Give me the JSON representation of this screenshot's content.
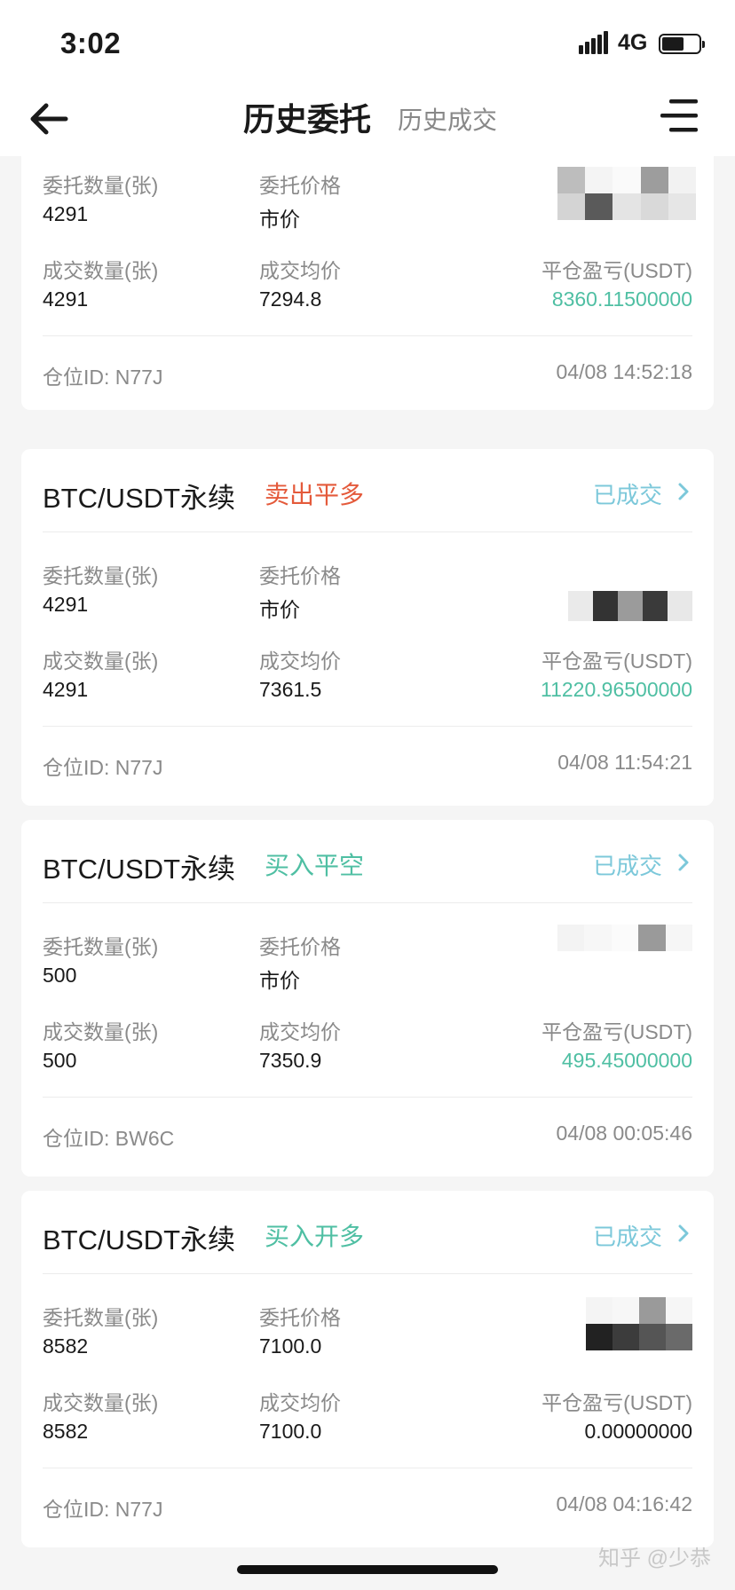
{
  "status_bar": {
    "time": "3:02",
    "network": "4G"
  },
  "nav": {
    "tab_active": "历史委托",
    "tab_inactive": "历史成交"
  },
  "labels": {
    "order_qty": "委托数量(张)",
    "order_price": "委托价格",
    "filled_qty": "成交数量(张)",
    "avg_price": "成交均价",
    "pnl": "平仓盈亏(USDT)"
  },
  "cards": [
    {
      "order_qty": "4291",
      "order_price": "市价",
      "filled_qty": "4291",
      "avg_price": "7294.8",
      "pnl": "8360.11500000",
      "position_id": "仓位ID: N77J",
      "time": "04/08 14:52:18"
    },
    {
      "pair": "BTC/USDT永续",
      "side": "卖出平多",
      "status": "已成交",
      "order_qty": "4291",
      "order_price": "市价",
      "filled_qty": "4291",
      "avg_price": "7361.5",
      "pnl": "11220.96500000",
      "position_id": "仓位ID: N77J",
      "time": "04/08 11:54:21"
    },
    {
      "pair": "BTC/USDT永续",
      "side": "买入平空",
      "status": "已成交",
      "order_qty": "500",
      "order_price": "市价",
      "filled_qty": "500",
      "avg_price": "7350.9",
      "pnl": "495.45000000",
      "position_id": "仓位ID: BW6C",
      "time": "04/08 00:05:46"
    },
    {
      "pair": "BTC/USDT永续",
      "side": "买入开多",
      "status": "已成交",
      "order_qty": "8582",
      "order_price": "7100.0",
      "filled_qty": "8582",
      "avg_price": "7100.0",
      "pnl": "0.00000000",
      "position_id": "仓位ID: N77J",
      "time": "04/08 04:16:42"
    }
  ],
  "watermark": "知乎 @少恭",
  "colors": {
    "sell": "#e45a3b",
    "buy": "#4fbfa3",
    "status": "#7cc8da"
  },
  "icons": [
    "signal-icon",
    "battery-icon",
    "back-arrow-icon",
    "menu-icon",
    "chevron-right-icon"
  ]
}
